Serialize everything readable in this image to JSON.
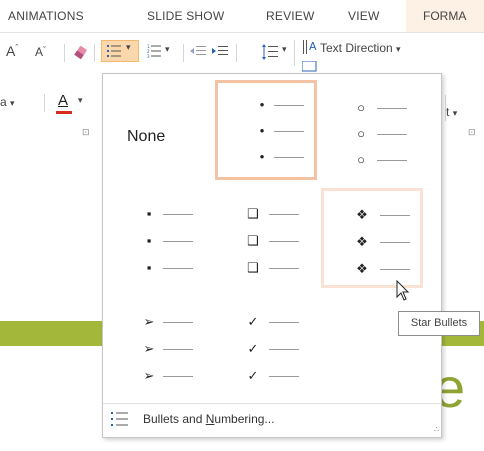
{
  "ribbon_tabs": [
    "ANIMATIONS",
    "SLIDE SHOW",
    "REVIEW",
    "VIEW"
  ],
  "active_tab": "FORMA",
  "toolbar": {
    "text_direction_label": "Text Direction",
    "text_direction_arrow": "▾",
    "font_size_up": "A",
    "font_size_down": "A",
    "font_size_up_mark": "ˆ",
    "font_size_down_mark": "ˇ",
    "font_color_letter": "A",
    "highlight_letter": "a",
    "align_partial": "t",
    "align_small": "⊡",
    "align_small_2": "⊡"
  },
  "gallery": {
    "none_label": "None",
    "sections": [
      {
        "style": "small-dot",
        "glyph": "•"
      },
      {
        "style": "hollow-circle",
        "glyph": "○"
      },
      {
        "style": "filled-square",
        "glyph": "▪"
      },
      {
        "style": "hollow-square",
        "glyph": "❑"
      },
      {
        "style": "star",
        "glyph": "❖"
      },
      {
        "style": "arrow",
        "glyph": "➢"
      },
      {
        "style": "check",
        "glyph": "✓"
      }
    ],
    "footer_label": "Bullets and Numbering...",
    "footer_underline_letter": "N"
  },
  "tooltip": "Star Bullets",
  "slide": {
    "partial_text": "e"
  },
  "colors": {
    "format_tab_bg": "#fdf0e4",
    "selected_border": "#f4c3a5",
    "hover_border": "#f9e1d3",
    "accent_green": "#a3b83b",
    "font_color_red": "#d62d20"
  }
}
